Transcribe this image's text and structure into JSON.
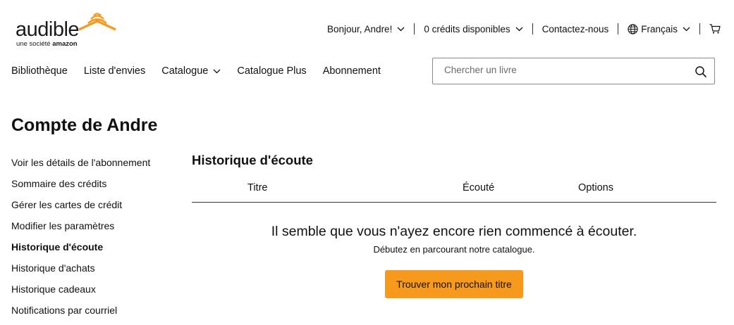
{
  "brand": {
    "wordmark": "audible",
    "tagline_prefix": "une société",
    "tagline_brand": "amazon",
    "accent": "#f7991c"
  },
  "util": {
    "greeting": "Bonjour, Andre!",
    "credits": "0 crédits disponibles",
    "contact": "Contactez-nous",
    "language": "Français"
  },
  "nav": {
    "library": "Bibliothèque",
    "wishlist": "Liste d'envies",
    "catalogue": "Catalogue",
    "catalogue_plus": "Catalogue Plus",
    "subscription": "Abonnement"
  },
  "search": {
    "placeholder": "Chercher un livre"
  },
  "page": {
    "title": "Compte de Andre"
  },
  "sidebar": {
    "items": [
      {
        "label": "Voir les détails de l'abonnement"
      },
      {
        "label": "Sommaire des crédits"
      },
      {
        "label": "Gérer les cartes de crédit"
      },
      {
        "label": "Modifier les paramètres"
      },
      {
        "label": "Historique d'écoute",
        "active": true
      },
      {
        "label": "Historique d'achats"
      },
      {
        "label": "Historique cadeaux"
      },
      {
        "label": "Notifications par courriel"
      }
    ]
  },
  "history": {
    "title": "Historique d'écoute",
    "columns": {
      "title": "Titre",
      "listened": "Écouté",
      "options": "Options"
    },
    "empty_title": "Il semble que vous n'ayez encore rien commencé à écouter.",
    "empty_sub": "Débutez en parcourant notre catalogue.",
    "cta": "Trouver mon prochain titre"
  }
}
